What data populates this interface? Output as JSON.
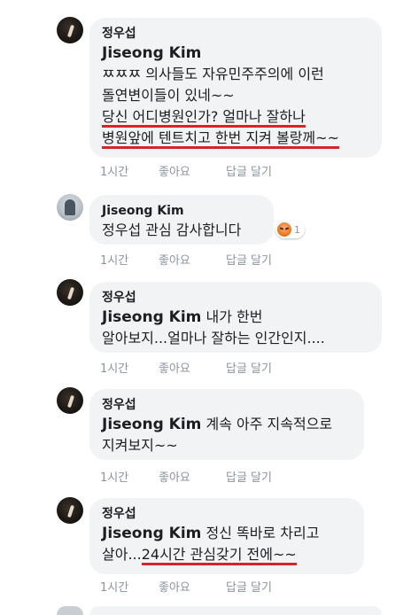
{
  "comments": [
    {
      "author": "정우섭",
      "tag": "Jiseong Kim",
      "lines": [
        "ㅉㅉㅉ 의사들도 자유민주주의에 이런",
        "돌연변이들이 있네~~",
        "당신 어디병원인가? 얼마나 잘하나",
        "병원앞에 텐트치고 한번 지켜 볼랑께~~"
      ],
      "actions": {
        "time": "1시간",
        "like": "좋아요",
        "reply": "답글 달기"
      }
    },
    {
      "author": "Jiseong Kim",
      "text": "정우섭 관심 감사합니다",
      "reaction": {
        "icon": "angry-reaction-icon",
        "count": "1"
      },
      "actions": {
        "time": "1시간",
        "like": "좋아요",
        "reply": "답글 달기"
      }
    },
    {
      "author": "정우섭",
      "tag": "Jiseong Kim",
      "text_after_tag": " 내가 한번",
      "line2": "알아보지...얼마나 잘하는 인간인지....",
      "actions": {
        "time": "1시간",
        "like": "좋아요",
        "reply": "답글 달기"
      }
    },
    {
      "author": "정우섭",
      "tag": "Jiseong Kim",
      "text_after_tag": " 계속 아주 지속적으로",
      "line2": "지켜보지~~",
      "actions": {
        "time": "1시간",
        "like": "좋아요",
        "reply": "답글 달기"
      }
    },
    {
      "author": "정우섭",
      "tag": "Jiseong Kim",
      "text_after_tag": " 정신 똑바로 차리고",
      "line2_a": "살아...",
      "line2_b": "24시간 관심갖기 전에~~",
      "actions": {
        "time": "1시간",
        "like": "좋아요",
        "reply": "답글 달기"
      }
    }
  ],
  "colors": {
    "bubble": "#f2f3f5",
    "underline": "#d8232a",
    "meta": "#8d949e"
  }
}
